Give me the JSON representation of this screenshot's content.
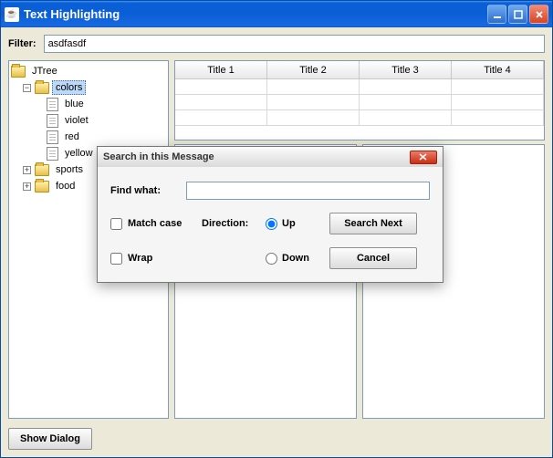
{
  "window": {
    "title": "Text Highlighting"
  },
  "filter": {
    "label": "Filter:",
    "value": "asdfasdf"
  },
  "tree": {
    "root": "JTree",
    "nodes": [
      {
        "label": "colors",
        "selected": true,
        "expanded": true,
        "children": [
          "blue",
          "violet",
          "red",
          "yellow"
        ]
      },
      {
        "label": "sports",
        "selected": false,
        "expanded": false
      },
      {
        "label": "food",
        "selected": false,
        "expanded": false
      }
    ]
  },
  "table": {
    "columns": [
      "Title 1",
      "Title 2",
      "Title 3",
      "Title 4"
    ]
  },
  "buttons": {
    "show_dialog": "Show Dialog"
  },
  "dialog": {
    "title": "Search in this Message",
    "find_label": "Find what:",
    "find_value": "",
    "match_case": "Match case",
    "wrap": "Wrap",
    "direction_label": "Direction:",
    "up": "Up",
    "down": "Down",
    "search_next": "Search Next",
    "cancel": "Cancel",
    "direction_selected": "up"
  }
}
